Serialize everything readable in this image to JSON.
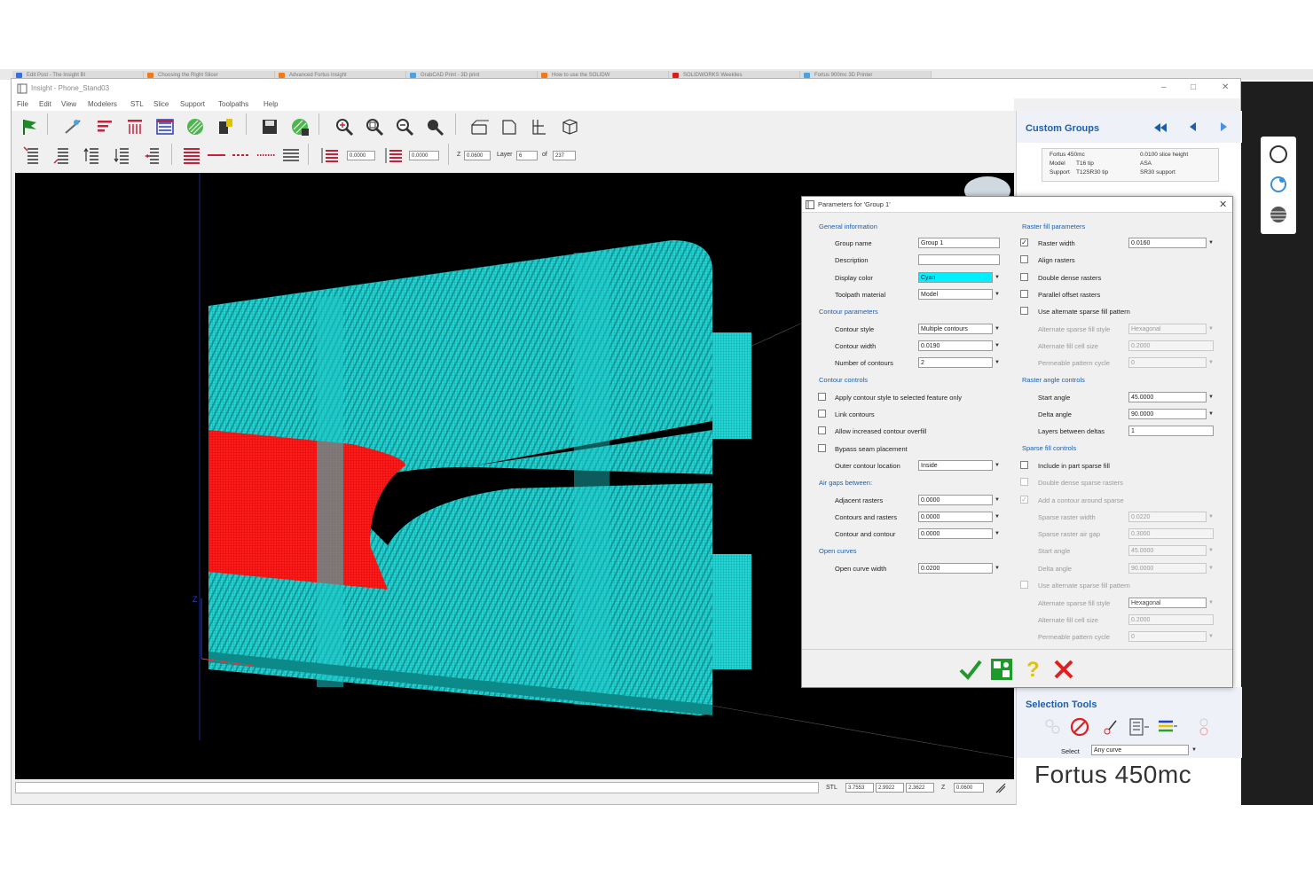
{
  "browser_tabs": [
    "Edit Post - The Insight Bl",
    "Choosing the Right Slicer",
    "Advanced Fortus Insight",
    "GrabCAD Print - 3D print",
    "How to use the SOLIDW",
    "SOLIDWORKS Weeklies",
    "Fortus 900mc 3D Printer"
  ],
  "window": {
    "title": "Insight - Phone_Stand03"
  },
  "menu": [
    "File",
    "Edit",
    "View",
    "Modelers",
    "STL",
    "Slice",
    "Support",
    "Toolpaths",
    "Help"
  ],
  "toolbar2": {
    "field1": "0.0000",
    "field2": "0.0000",
    "z_label": "Z",
    "z_value": "0.0600",
    "layer_label": "Layer",
    "layer_value": "6",
    "of_label": "of",
    "of_value": "237"
  },
  "custom_groups": {
    "title": "Custom Groups",
    "info": {
      "printer": "Fortus 450mc",
      "slice": "0.0100 slice height",
      "model_label": "Model",
      "model_tip": "T16 tip",
      "model_material": "ASA",
      "support_label": "Support",
      "support_tip": "T12SR30 tip",
      "support_material": "SR30 support"
    }
  },
  "selection_tools": {
    "title": "Selection Tools",
    "select_label": "Select",
    "select_value": "Any curve"
  },
  "brand": "Fortus 450mc",
  "statusbar": {
    "stl_label": "STL",
    "v1": "3.7553",
    "v2": "2.9922",
    "v3": "2.3622",
    "z_label": "Z",
    "z_value": "0.0600"
  },
  "dialog": {
    "title": "Parameters for 'Group 1'",
    "left": {
      "general_info": "General information",
      "group_name_label": "Group name",
      "group_name": "Group 1",
      "description_label": "Description",
      "description": "",
      "display_color_label": "Display color",
      "display_color": "Cyan",
      "toolpath_material_label": "Toolpath material",
      "toolpath_material": "Model",
      "contour_params": "Contour parameters",
      "contour_style_label": "Contour style",
      "contour_style": "Multiple contours",
      "contour_width_label": "Contour width",
      "contour_width": "0.0190",
      "num_contours_label": "Number of contours",
      "num_contours": "2",
      "contour_controls": "Contour controls",
      "apply_contour": "Apply contour style to selected feature only",
      "link_contours": "Link contours",
      "allow_overfill": "Allow increased contour overfill",
      "bypass_seam": "Bypass seam placement",
      "outer_loc_label": "Outer contour location",
      "outer_loc": "Inside",
      "air_gaps": "Air gaps between:",
      "adjacent_label": "Adjacent rasters",
      "adjacent": "0.0000",
      "contours_rasters_label": "Contours and rasters",
      "contours_rasters": "0.0000",
      "contour_contour_label": "Contour and contour",
      "contour_contour": "0.0000",
      "open_curves": "Open curves",
      "open_width_label": "Open curve width",
      "open_width": "0.0200"
    },
    "right": {
      "raster_params": "Raster fill parameters",
      "raster_width_label": "Raster width",
      "raster_width": "0.0160",
      "align_rasters": "Align rasters",
      "double_dense": "Double dense rasters",
      "parallel_offset": "Parallel offset rasters",
      "use_alt_sparse": "Use alternate sparse fill pattern",
      "alt_style_label": "Alternate sparse fill style",
      "alt_style": "Hexagonal",
      "alt_cell_label": "Alternate fill cell size",
      "alt_cell": "0.2000",
      "perm_cycle_label": "Permeable pattern cycle",
      "perm_cycle": "0",
      "raster_angle": "Raster angle controls",
      "start_angle_label": "Start angle",
      "start_angle": "45.0000",
      "delta_angle_label": "Delta angle",
      "delta_angle": "90.0000",
      "layers_between_label": "Layers between deltas",
      "layers_between": "1",
      "sparse_fill": "Sparse fill controls",
      "include_sparse": "Include in part sparse fill",
      "double_sparse": "Double dense sparse rasters",
      "add_contour_sparse": "Add a contour around sparse",
      "sparse_width_label": "Sparse raster width",
      "sparse_width": "0.0220",
      "sparse_gap_label": "Sparse raster air gap",
      "sparse_gap": "0.3000",
      "sp_start_label": "Start angle",
      "sp_start": "45.0000",
      "sp_delta_label": "Delta angle",
      "sp_delta": "90.0000",
      "use_alt_sparse2": "Use alternate sparse fill pattern",
      "alt_style2_label": "Alternate sparse fill style",
      "alt_style2": "Hexagonal",
      "alt_cell2_label": "Alternate fill cell size",
      "alt_cell2": "0.2000",
      "perm_cycle2_label": "Permeable pattern cycle",
      "perm_cycle2": "0"
    }
  },
  "axis_label": "Z",
  "colors": {
    "model": "#2ee8e8",
    "selected": "#ff1a1a",
    "accent": "#1a5fb4"
  }
}
